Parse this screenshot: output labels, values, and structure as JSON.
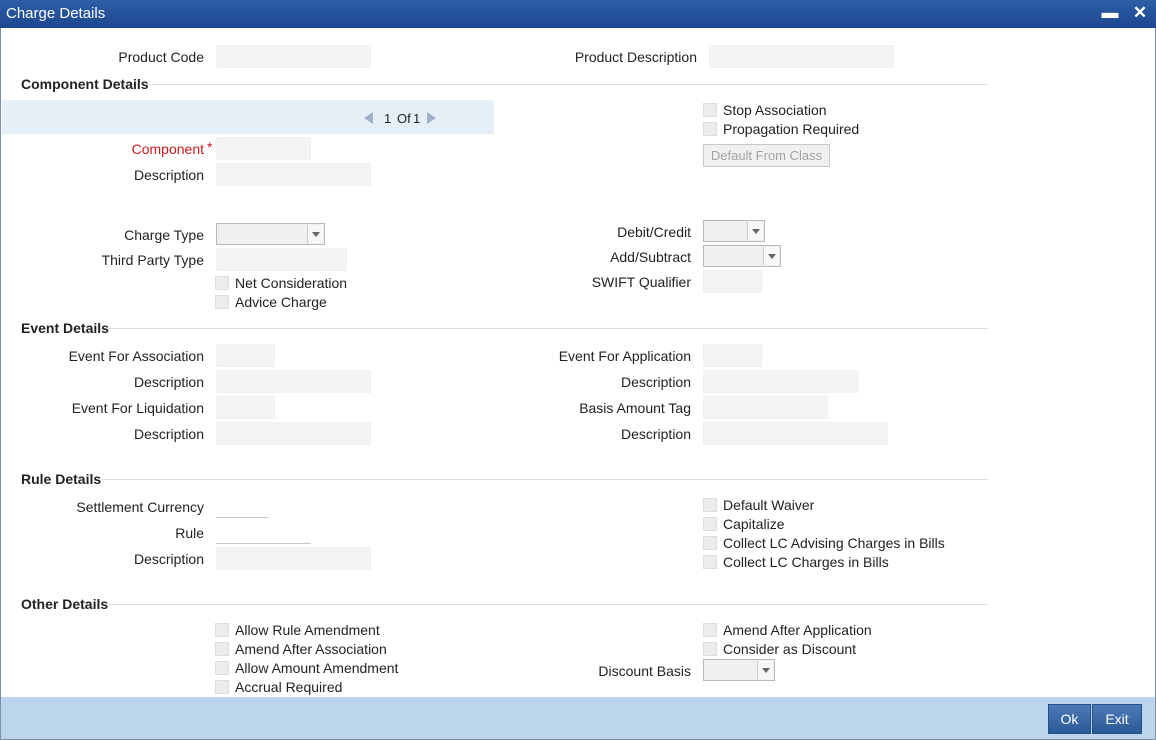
{
  "window": {
    "title": "Charge Details",
    "minimize_glyph": "▬",
    "close_glyph": "✕"
  },
  "header": {
    "product_code_label": "Product Code",
    "product_code_value": "",
    "product_description_label": "Product Description",
    "product_description_value": ""
  },
  "component_details": {
    "heading": "Component Details",
    "pager": {
      "current": "1",
      "of_label": "Of",
      "total": "1"
    },
    "component_label": "Component",
    "required_mark": "*",
    "description_label": "Description",
    "stop_association_label": "Stop Association",
    "propagation_required_label": "Propagation Required",
    "default_from_class_label": "Default From Class",
    "charge_type_label": "Charge Type",
    "third_party_type_label": "Third Party Type",
    "net_consideration_label": "Net Consideration",
    "advice_charge_label": "Advice Charge",
    "debit_credit_label": "Debit/Credit",
    "add_subtract_label": "Add/Subtract",
    "swift_qualifier_label": "SWIFT Qualifier"
  },
  "event_details": {
    "heading": "Event Details",
    "event_for_association_label": "Event For Association",
    "description_label": "Description",
    "event_for_liquidation_label": "Event For Liquidation",
    "event_for_application_label": "Event For Application",
    "basis_amount_tag_label": "Basis Amount Tag"
  },
  "rule_details": {
    "heading": "Rule Details",
    "settlement_currency_label": "Settlement Currency",
    "rule_label": "Rule",
    "description_label": "Description",
    "default_waiver_label": "Default Waiver",
    "capitalize_label": "Capitalize",
    "collect_lc_advising_label": "Collect LC Advising Charges in Bills",
    "collect_lc_charges_label": "Collect LC Charges in Bills"
  },
  "other_details": {
    "heading": "Other Details",
    "allow_rule_amendment_label": "Allow Rule Amendment",
    "amend_after_association_label": "Amend After Association",
    "allow_amount_amendment_label": "Allow Amount Amendment",
    "accrual_required_label": "Accrual Required",
    "amend_after_application_label": "Amend After Application",
    "consider_as_discount_label": "Consider as Discount",
    "discount_basis_label": "Discount Basis"
  },
  "footer": {
    "ok_label": "Ok",
    "exit_label": "Exit"
  },
  "colors": {
    "titlebar": "#1c4790",
    "required": "#cc1a1a",
    "footer": "#bcd4ec",
    "button": "#2b5a98"
  }
}
